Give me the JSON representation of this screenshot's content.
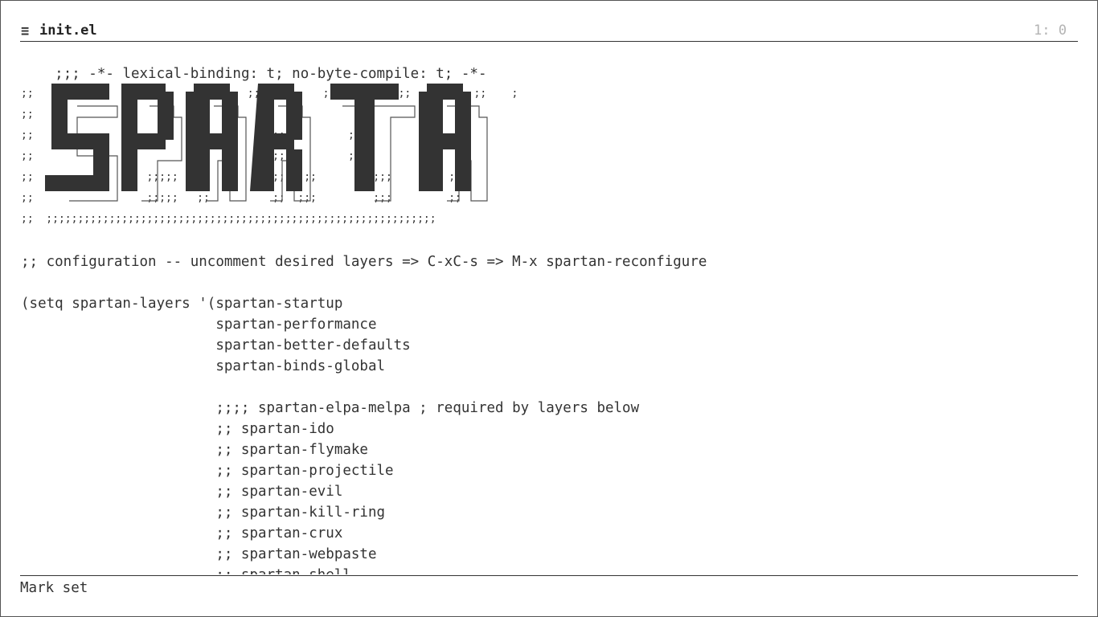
{
  "modeline": {
    "icon": "≡",
    "icon_name": "hamburger-menu-icon",
    "buffer_name": "init.el",
    "position": "1: 0"
  },
  "banner": {
    "art_text": "SPARTA",
    "semicolon_rows": [
      ";;                  ;;;             ;;          ;;          ;;          ;;    ;",
      ";;",
      ";;                                      ;;;         ;;;",
      ";;                                      ;;;         ;;;",
      ";;                  ;;;;;   ;;          ;;  ;;;         ;;;         ;;",
      ";;                  ;;;;;   ;;          ;;  ;;;         ;;;         ;;",
      ";;  ;;;;;;;;;;;;;;;;;;;;;;;;;;;;;;;;;;;;;;;;;;;;;;;;;;;;;;;;;;;;;;"
    ]
  },
  "code_lines": [
    ";;; -*- lexical-binding: t; no-byte-compile: t; -*-",
    ";; configuration -- uncomment desired layers => C-xC-s => M-x spartan-reconfigure",
    "(setq spartan-layers '(spartan-startup",
    "                       spartan-performance",
    "                       spartan-better-defaults",
    "                       spartan-binds-global",
    "                       ;;;; spartan-elpa-melpa ; required by layers below",
    "                       ;; spartan-ido",
    "                       ;; spartan-flymake",
    "                       ;; spartan-projectile",
    "                       ;; spartan-evil",
    "                       ;; spartan-kill-ring",
    "                       ;; spartan-crux",
    "                       ;; spartan-webpaste",
    "                       ;; spartan-shell"
  ],
  "minibuffer": {
    "message": "Mark set"
  },
  "colors": {
    "text": "#333333",
    "position": "#b3b3b3",
    "art_fill": "#333333",
    "art_shadow": "#555555",
    "background": "#ffffff"
  }
}
